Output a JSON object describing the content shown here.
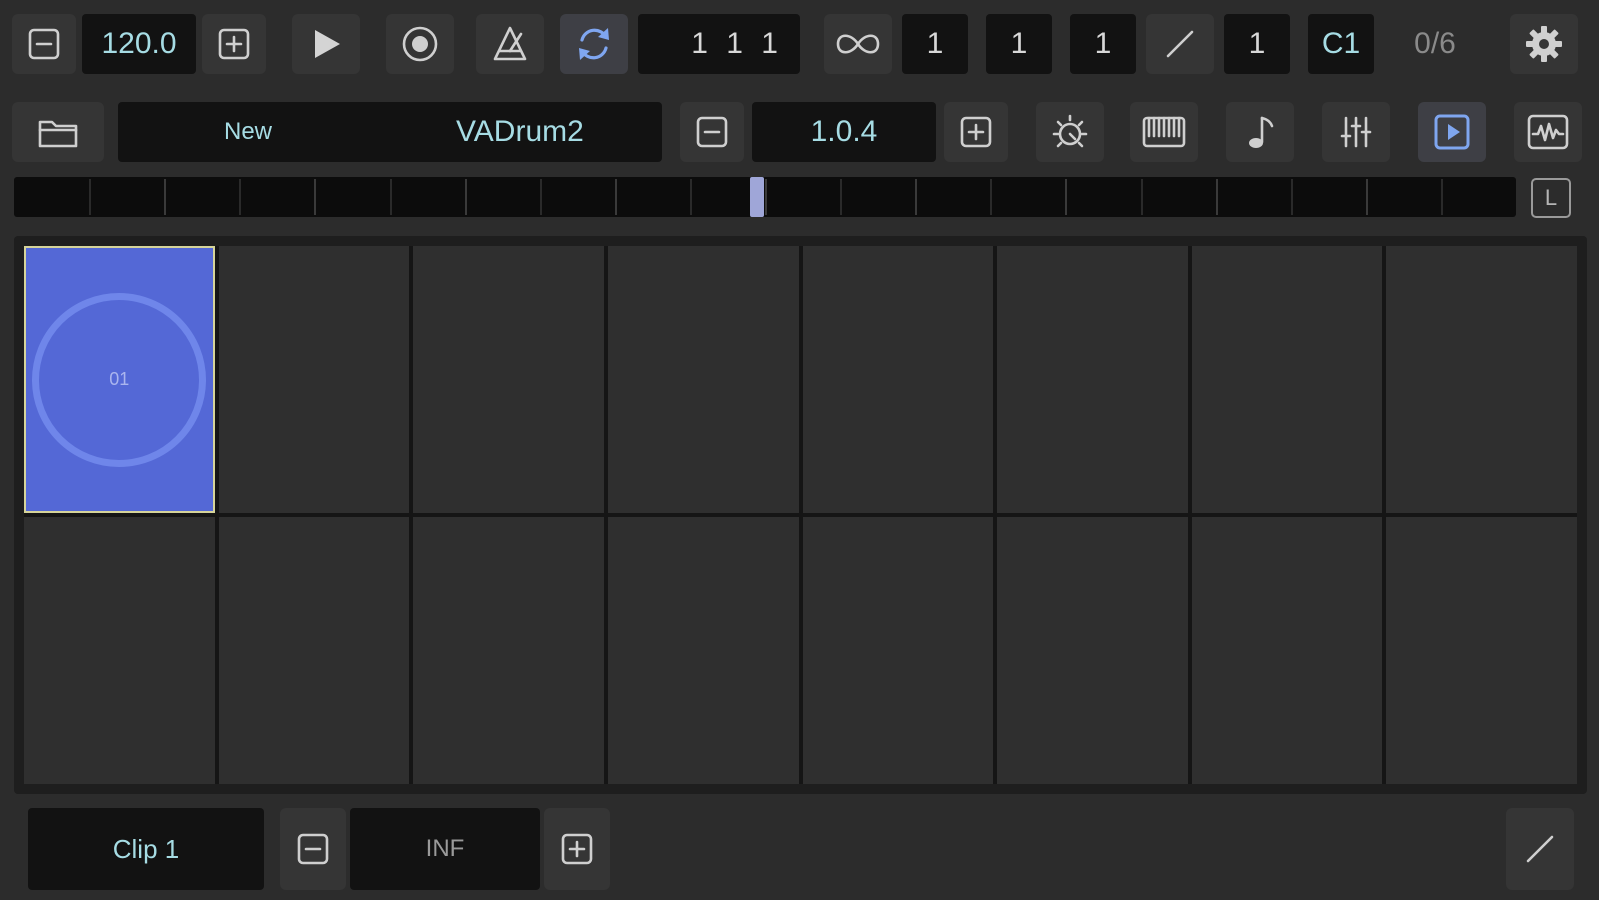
{
  "transport": {
    "tempo": "120.0",
    "position": "1  1  1",
    "loop_bars": "1",
    "loop_beats": "1",
    "loop_steps": "1",
    "quantize": "1",
    "root_note": "C1",
    "counter": "0/6"
  },
  "project": {
    "new_label": "New",
    "instrument_name": "VADrum2",
    "version": "1.0.4"
  },
  "timeline": {
    "loop_marker_label": "L",
    "playhead_fraction": 0.495
  },
  "grid": {
    "columns": 8,
    "rows": 2,
    "clips": [
      {
        "label": "01",
        "filled": true
      },
      {
        "label": "",
        "filled": false
      },
      {
        "label": "",
        "filled": false
      },
      {
        "label": "",
        "filled": false
      },
      {
        "label": "",
        "filled": false
      },
      {
        "label": "",
        "filled": false
      },
      {
        "label": "",
        "filled": false
      },
      {
        "label": "",
        "filled": false
      },
      {
        "label": "",
        "filled": false
      },
      {
        "label": "",
        "filled": false
      },
      {
        "label": "",
        "filled": false
      },
      {
        "label": "",
        "filled": false
      },
      {
        "label": "",
        "filled": false
      },
      {
        "label": "",
        "filled": false
      },
      {
        "label": "",
        "filled": false
      },
      {
        "label": "",
        "filled": false
      }
    ]
  },
  "footer": {
    "clip_name": "Clip 1",
    "repeat_value": "INF"
  },
  "colors": {
    "accent_blue": "#5468d6",
    "text_cyan": "#a6dce4",
    "active_icon": "#7fa6f0"
  }
}
